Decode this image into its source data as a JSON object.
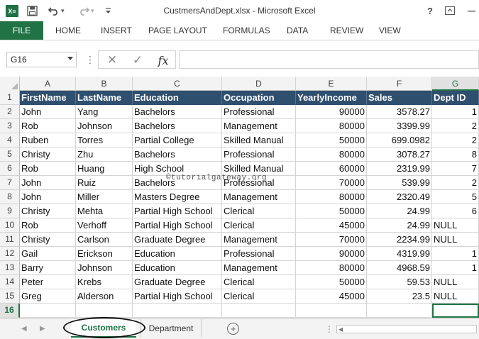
{
  "app": {
    "logo_text": "X≡",
    "title": "CustmersAndDept.xlsx - Microsoft Excel",
    "help_label": "?",
    "icons": [
      "excel-logo-icon",
      "save-icon",
      "undo-icon",
      "redo-icon",
      "customize-toolbar-icon",
      "help-icon",
      "ribbon-display-icon",
      "minimize-icon"
    ]
  },
  "ribbon": {
    "tabs": [
      "FILE",
      "HOME",
      "INSERT",
      "PAGE LAYOUT",
      "FORMULAS",
      "DATA",
      "REVIEW",
      "VIEW"
    ]
  },
  "formula_bar": {
    "name_box": "G16",
    "separator": "⋮",
    "cancel_glyph": "✕",
    "enter_glyph": "✓",
    "fx_label": "fx",
    "value": ""
  },
  "grid": {
    "columns": [
      "A",
      "B",
      "C",
      "D",
      "E",
      "F",
      "G"
    ],
    "active_column": "G",
    "active_row": "16",
    "row_numbers": [
      "1",
      "2",
      "3",
      "4",
      "5",
      "6",
      "7",
      "8",
      "9",
      "10",
      "11",
      "12",
      "13",
      "14",
      "15",
      "16"
    ],
    "header": [
      "FirstName",
      "LastName",
      "Education",
      "Occupation",
      "YearlyIncome",
      "Sales",
      "Dept ID"
    ],
    "rows": [
      [
        "John",
        "Yang",
        "Bachelors",
        "Professional",
        "90000",
        "3578.27",
        "1"
      ],
      [
        "Rob",
        "Johnson",
        "Bachelors",
        "Management",
        "80000",
        "3399.99",
        "2"
      ],
      [
        "Ruben",
        "Torres",
        "Partial College",
        "Skilled Manual",
        "50000",
        "699.0982",
        "2"
      ],
      [
        "Christy",
        "Zhu",
        "Bachelors",
        "Professional",
        "80000",
        "3078.27",
        "8"
      ],
      [
        "Rob",
        "Huang",
        "High School",
        "Skilled Manual",
        "60000",
        "2319.99",
        "7"
      ],
      [
        "John",
        "Ruiz",
        "Bachelors",
        "Professional",
        "70000",
        "539.99",
        "2"
      ],
      [
        "John",
        "Miller",
        "Masters Degree",
        "Management",
        "80000",
        "2320.49",
        "5"
      ],
      [
        "Christy",
        "Mehta",
        "Partial High School",
        "Clerical",
        "50000",
        "24.99",
        "6"
      ],
      [
        "Rob",
        "Verhoff",
        "Partial High School",
        "Clerical",
        "45000",
        "24.99",
        "NULL"
      ],
      [
        "Christy",
        "Carlson",
        "Graduate Degree",
        "Management",
        "70000",
        "2234.99",
        "NULL"
      ],
      [
        "Gail",
        "Erickson",
        "Education",
        "Professional",
        "90000",
        "4319.99",
        "1"
      ],
      [
        "Barry",
        "Johnson",
        "Education",
        "Management",
        "80000",
        "4968.59",
        "1"
      ],
      [
        "Peter",
        "Krebs",
        "Graduate Degree",
        "Clerical",
        "50000",
        "59.53",
        "NULL"
      ],
      [
        "Greg",
        "Alderson",
        "Partial High School",
        "Clerical",
        "45000",
        "23.5",
        "NULL"
      ]
    ]
  },
  "watermark": "©tutorialgateway.org",
  "sheets": {
    "tabs": [
      "Customers",
      "Department"
    ],
    "active": "Customers",
    "add_label": "+",
    "dots": "⋮"
  },
  "colors": {
    "excel_green": "#217346",
    "header_fill": "#2f4f6f"
  }
}
